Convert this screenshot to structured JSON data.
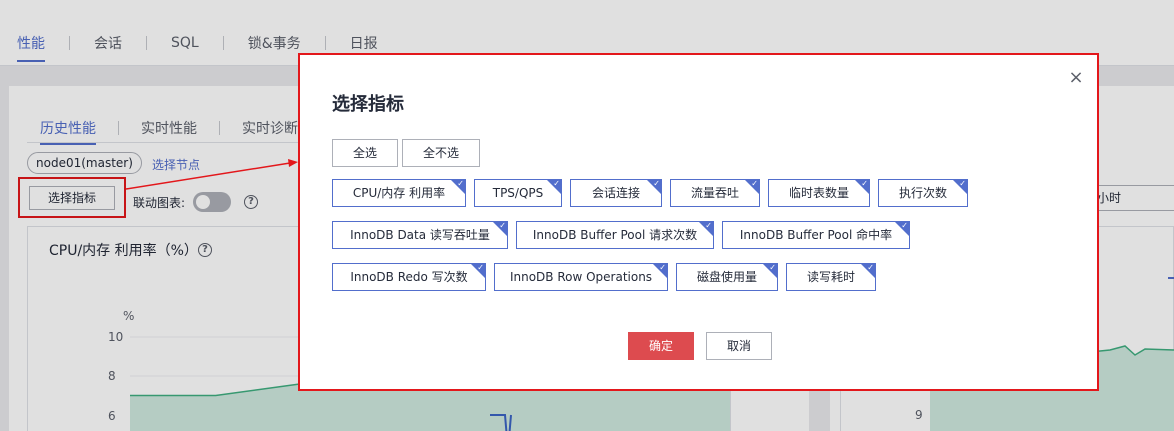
{
  "main_tabs": [
    "性能",
    "会话",
    "SQL",
    "锁&事务",
    "日报"
  ],
  "sub_tabs": [
    "历史性能",
    "实时性能",
    "实时诊断"
  ],
  "node": {
    "chip": "node01(master)",
    "select_label": "选择节点"
  },
  "toolbar": {
    "select_metric": "选择指标",
    "link_label": "联动图表:"
  },
  "chart": {
    "title": "CPU/内存 利用率（%）",
    "unit": "%",
    "ticks": [
      "10",
      "8",
      "6"
    ],
    "right_tick": "9",
    "time_select": "小时"
  },
  "chart_data": {
    "type": "line",
    "ylabel": "%",
    "y_ticks": [
      10,
      8,
      6
    ],
    "series": [
      {
        "values": [
          7.0,
          7.0,
          7.6,
          7.6,
          7.9,
          7.9,
          8.0,
          8.0
        ]
      },
      {
        "values": [
          6.0,
          6.0,
          6.0,
          6.0,
          6.0,
          6.0,
          4.2,
          6.0
        ]
      }
    ]
  },
  "dialog": {
    "title": "选择指标",
    "select_all": "全选",
    "select_none": "全不选",
    "options": [
      "CPU/内存 利用率",
      "TPS/QPS",
      "会话连接",
      "流量吞吐",
      "临时表数量",
      "执行次数",
      "InnoDB Data 读写吞吐量",
      "InnoDB Buffer Pool 请求次数",
      "InnoDB Buffer Pool 命中率",
      "InnoDB Redo 写次数",
      "InnoDB Row Operations",
      "磁盘使用量",
      "读写耗时"
    ],
    "ok": "确定",
    "cancel": "取消"
  },
  "colors": {
    "accent": "#526ecc",
    "danger": "#dd4b4f",
    "highlight": "#e3171b",
    "chart_fill": "#cfe9df",
    "chart_line": "#3fae80"
  }
}
